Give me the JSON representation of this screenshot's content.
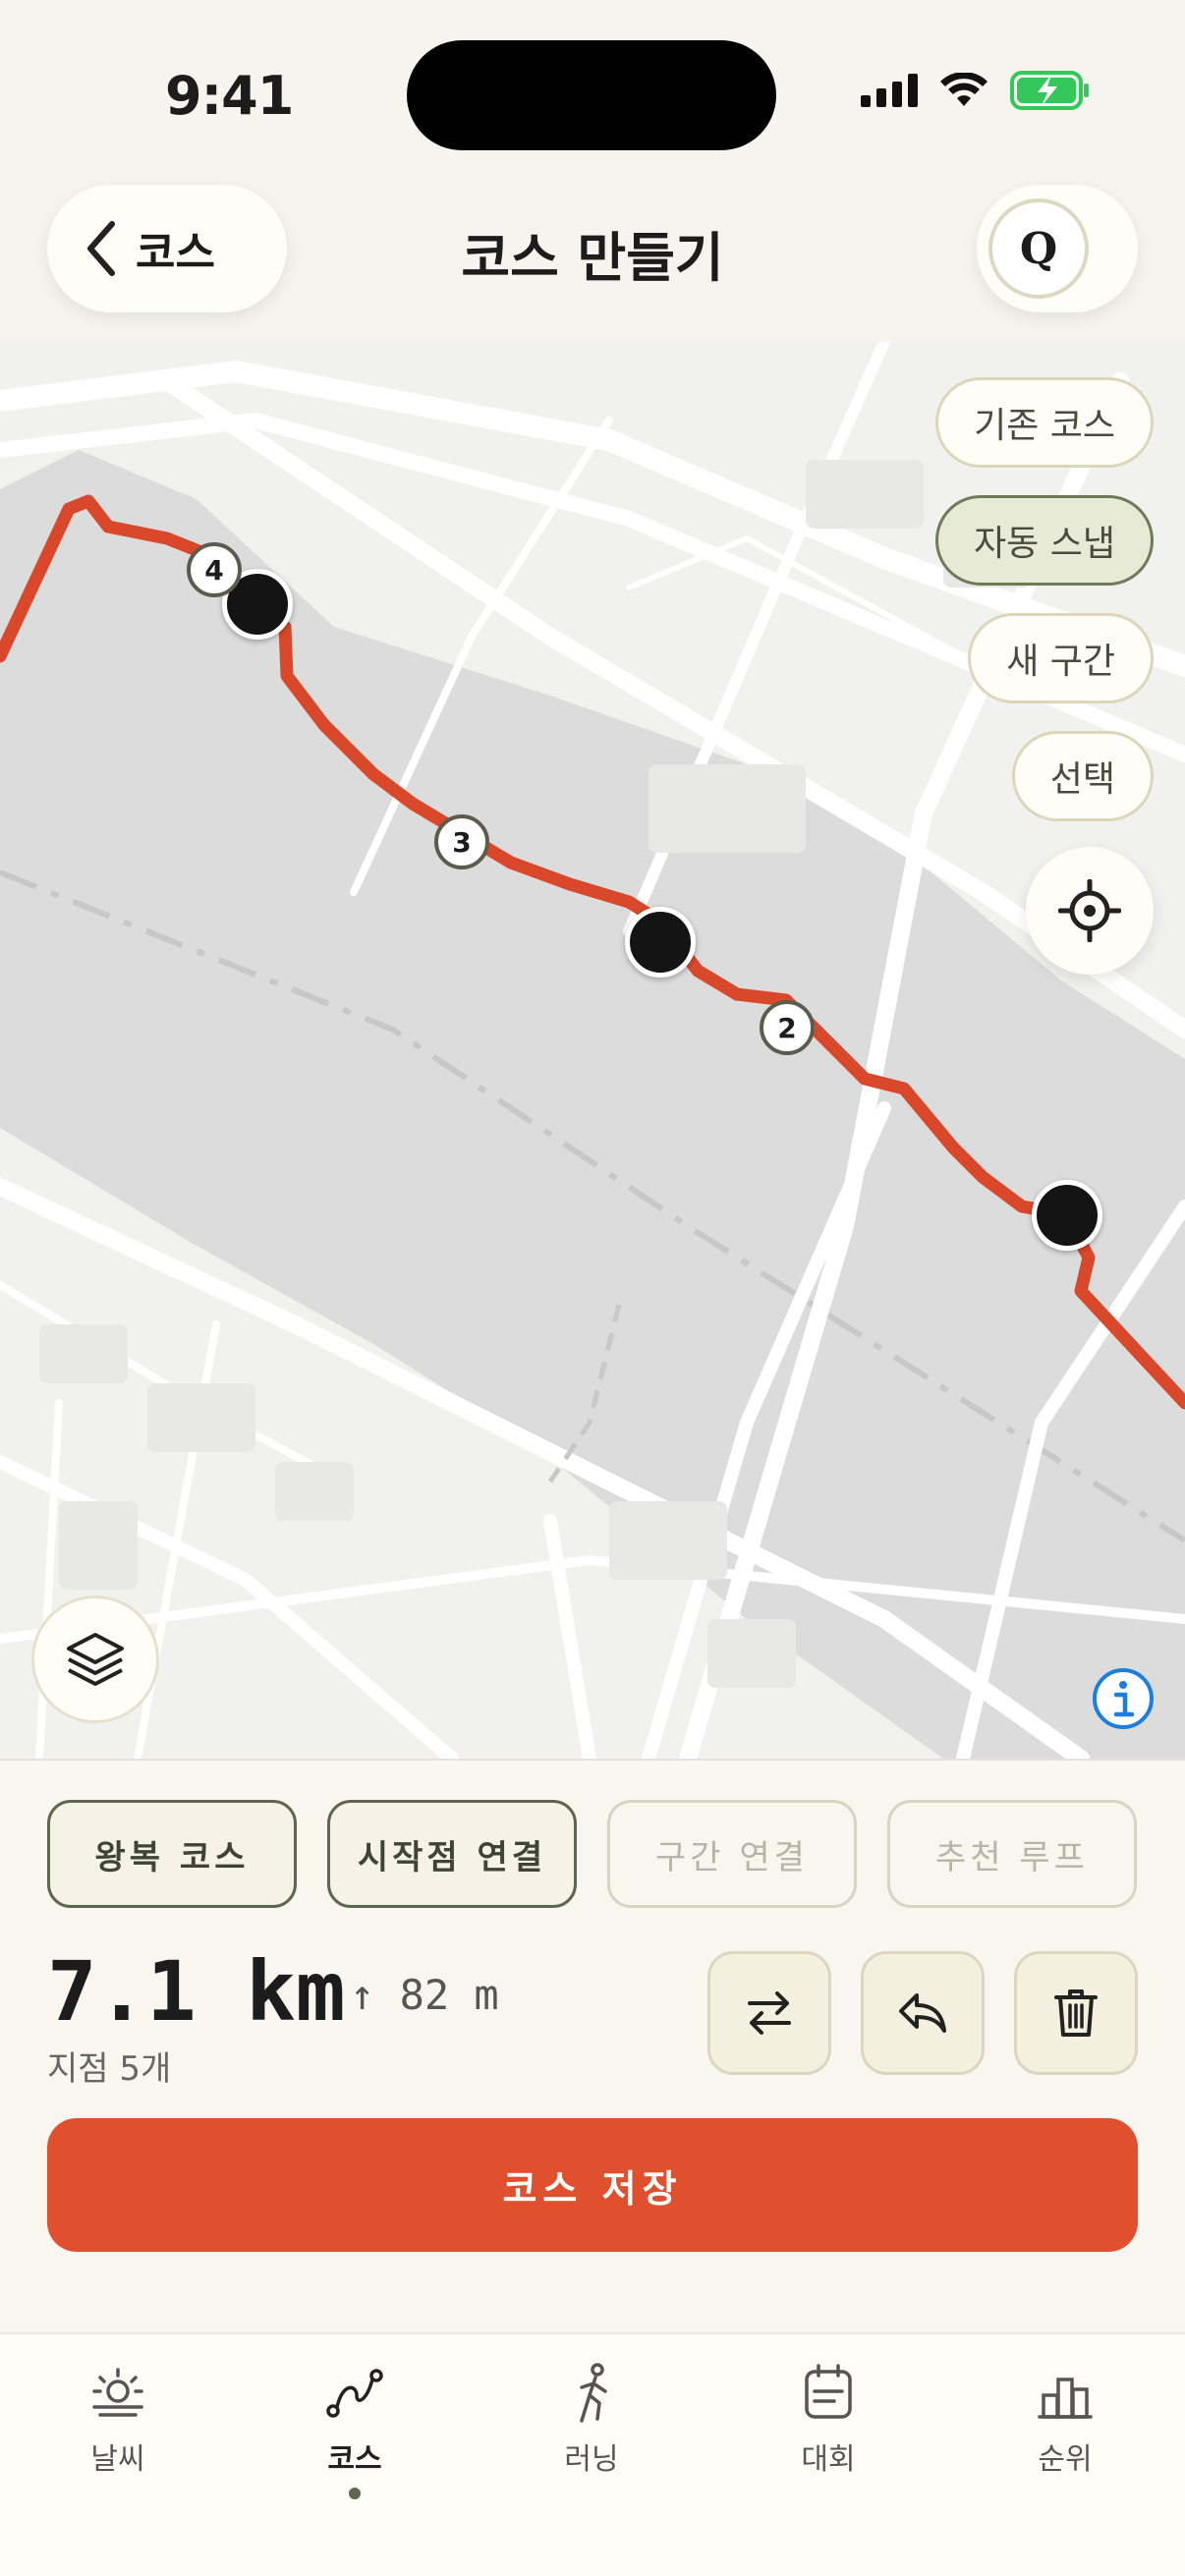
{
  "status_bar": {
    "time": "9:41"
  },
  "header": {
    "back_label": "코스",
    "title": "코스 만들기",
    "profile_initial": "Q"
  },
  "map": {
    "chips": [
      {
        "label": "기존 코스",
        "active": false
      },
      {
        "label": "자동 스냅",
        "active": true
      },
      {
        "label": "새 구간",
        "active": false
      },
      {
        "label": "선택",
        "active": false
      }
    ],
    "waypoints": [
      "2",
      "3",
      "4"
    ]
  },
  "panel": {
    "segments": [
      {
        "label": "왕복 코스",
        "enabled": true
      },
      {
        "label": "시작점 연결",
        "enabled": true
      },
      {
        "label": "구간 연결",
        "enabled": false
      },
      {
        "label": "추천 루프",
        "enabled": false
      }
    ],
    "distance": "7.1 km",
    "elevation": "↑ 82 m",
    "points": "지점 5개",
    "save_label": "코스 저장"
  },
  "tabs": [
    {
      "label": "날씨",
      "icon": "sun-icon"
    },
    {
      "label": "코스",
      "icon": "route-icon",
      "active": true
    },
    {
      "label": "러닝",
      "icon": "runner-icon"
    },
    {
      "label": "대회",
      "icon": "calendar-icon"
    },
    {
      "label": "순위",
      "icon": "ranking-icon"
    }
  ],
  "colors": {
    "route": "#d9482b",
    "accent": "#5c6650",
    "save": "#e0502f"
  }
}
